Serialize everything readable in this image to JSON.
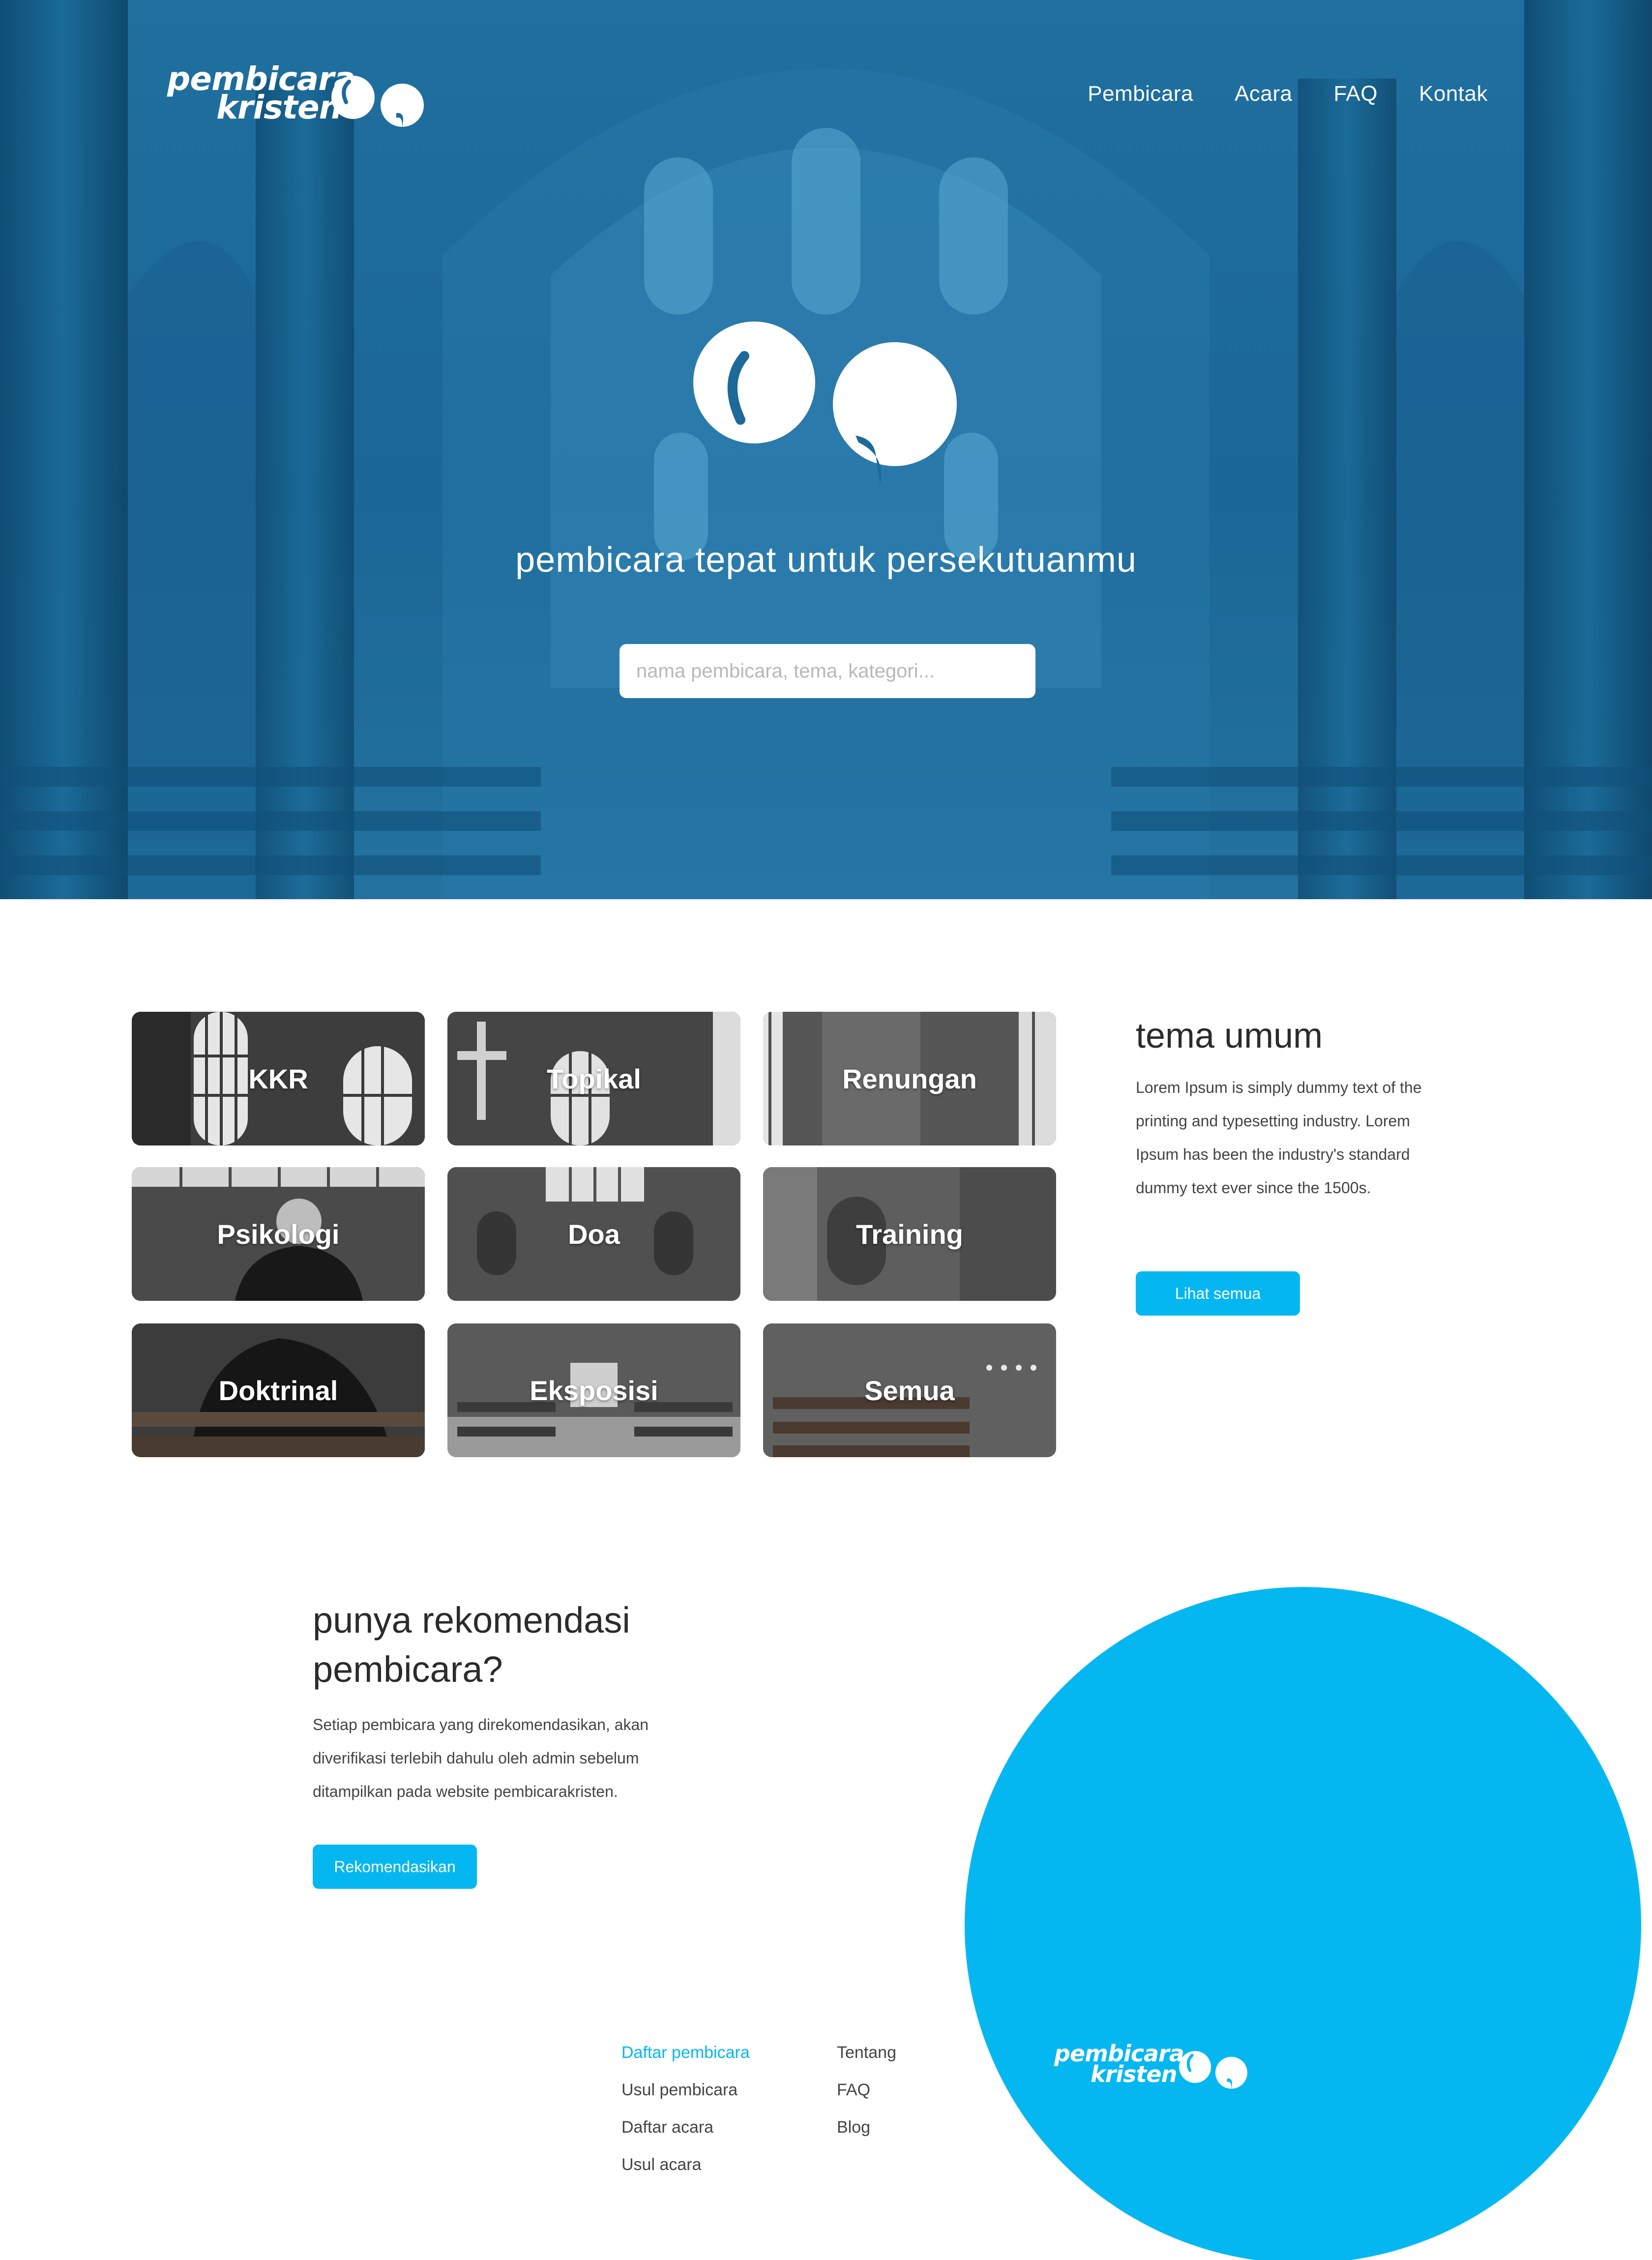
{
  "brand": {
    "line1": "pembicara",
    "line2": "kristen",
    "accent": "#05b7f1",
    "hero_blue": "#1b6a9a"
  },
  "nav": {
    "items": [
      "Pembicara",
      "Acara",
      "FAQ",
      "Kontak"
    ]
  },
  "hero": {
    "tagline": "pembicara tepat untuk persekutuanmu",
    "search_placeholder": "nama pembicara, tema, kategori..."
  },
  "topics": {
    "items": [
      "KKR",
      "Topikal",
      "Renungan",
      "Psikologi",
      "Doa",
      "Training",
      "Doktrinal",
      "Eksposisi",
      "Semua"
    ]
  },
  "sidebar": {
    "title": "tema umum",
    "text": "Lorem Ipsum is simply dummy text of the printing and typesetting industry. Lorem Ipsum has been the industry's standard dummy text ever since the 1500s.",
    "button": "Lihat semua"
  },
  "recommend": {
    "title": "punya rekomendasi pembicara?",
    "text": "Setiap pembicara yang direkomendasikan, akan diverifikasi terlebih dahulu oleh admin sebelum ditampilkan pada website pembicarakristen.",
    "button": "Rekomendasikan"
  },
  "footer": {
    "col1": [
      "Daftar pembicara",
      "Usul pembicara",
      "Daftar acara",
      "Usul acara"
    ],
    "col2": [
      "Tentang",
      "FAQ",
      "Blog"
    ]
  }
}
